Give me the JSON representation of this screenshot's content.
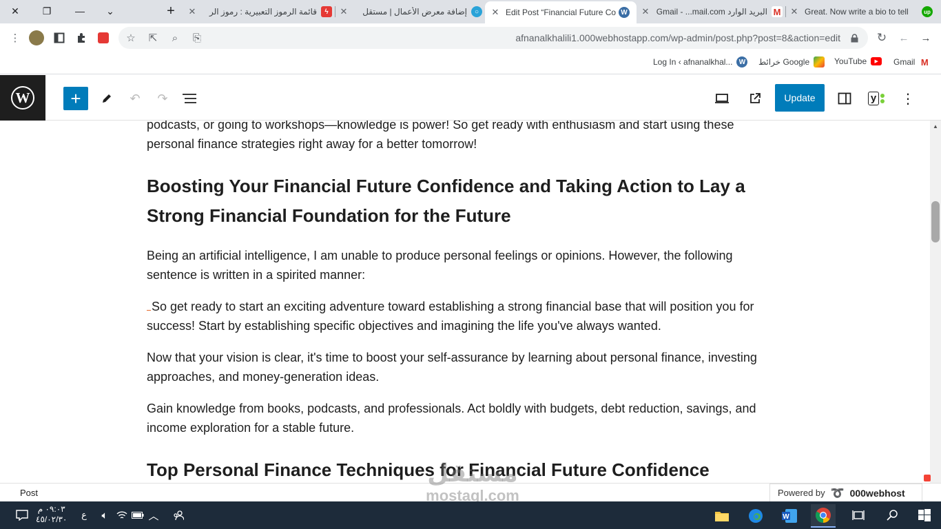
{
  "browser": {
    "window_controls": {
      "close": "✕",
      "restore": "❐",
      "minimize": "—",
      "tab_search": "⌄"
    },
    "new_tab": "+",
    "tabs": [
      {
        "label": "قائمة الرموز التعبيرية : رموز الر",
        "favicon": "red-bolt-icon"
      },
      {
        "label": "إضافة معرض الأعمال | مستقل",
        "favicon": "mostaql-icon"
      },
      {
        "label": "Edit Post “Financial Future Co",
        "favicon": "wordpress-icon",
        "active": true
      },
      {
        "label": "البريد الوارد Gmail - ...mail.com",
        "favicon": "gmail-icon"
      },
      {
        "label": "Great. Now write a bio to tell",
        "favicon": "upwork-icon"
      }
    ],
    "url": "afnanalkhalili1.000webhostapp.com/wp-admin/post.php?post=8&action=edit",
    "bookmarks": [
      {
        "label": "Log In ‹ afnanalkhal...",
        "icon": "wordpress-icon"
      },
      {
        "label": "خرائط Google",
        "icon": "maps-icon"
      },
      {
        "label": "YouTube",
        "icon": "youtube-icon"
      },
      {
        "label": "Gmail",
        "icon": "gmail-icon"
      }
    ]
  },
  "editor": {
    "update_label": "Update",
    "yoast_label": "y",
    "breadcrumb": "Post",
    "powered_by": "Powered by",
    "powered_brand": "000webhost"
  },
  "content": {
    "intro": "podcasts, or going to workshops—knowledge is power! So get ready with enthusiasm and start using these personal finance strategies right away for a better tomorrow!",
    "heading1": "Boosting Your Financial Future Confidence and Taking Action to Lay a Strong Financial Foundation for the Future",
    "p1": "Being an artificial intelligence, I am unable to produce personal feelings or opinions. However, the following sentence is written in a spirited manner:",
    "p2": "So get ready to start an exciting adventure toward establishing a strong financial base that will position you for success! Start by establishing specific objectives and imagining the life you've always wanted.",
    "p3": "Now that your vision is clear, it's time to boost your self-assurance by learning about personal finance, investing approaches, and money-generation ideas.",
    "p4": "Gain knowledge from books, podcasts, and professionals. Act boldly with budgets, debt reduction, savings, and income exploration for a stable future.",
    "heading2": "Top Personal Finance Techniques for Financial Future Confidence"
  },
  "watermark": {
    "arabic": "مستقل",
    "latin": "mostaql.com"
  },
  "taskbar": {
    "time": "٠٩:٠٣ م",
    "date": "٤٥/٠٢/٣٠",
    "lang": "ع"
  },
  "colors": {
    "wp_blue": "#007cba",
    "wp_dark": "#1e1e1e",
    "taskbar": "#1d2b3a"
  }
}
